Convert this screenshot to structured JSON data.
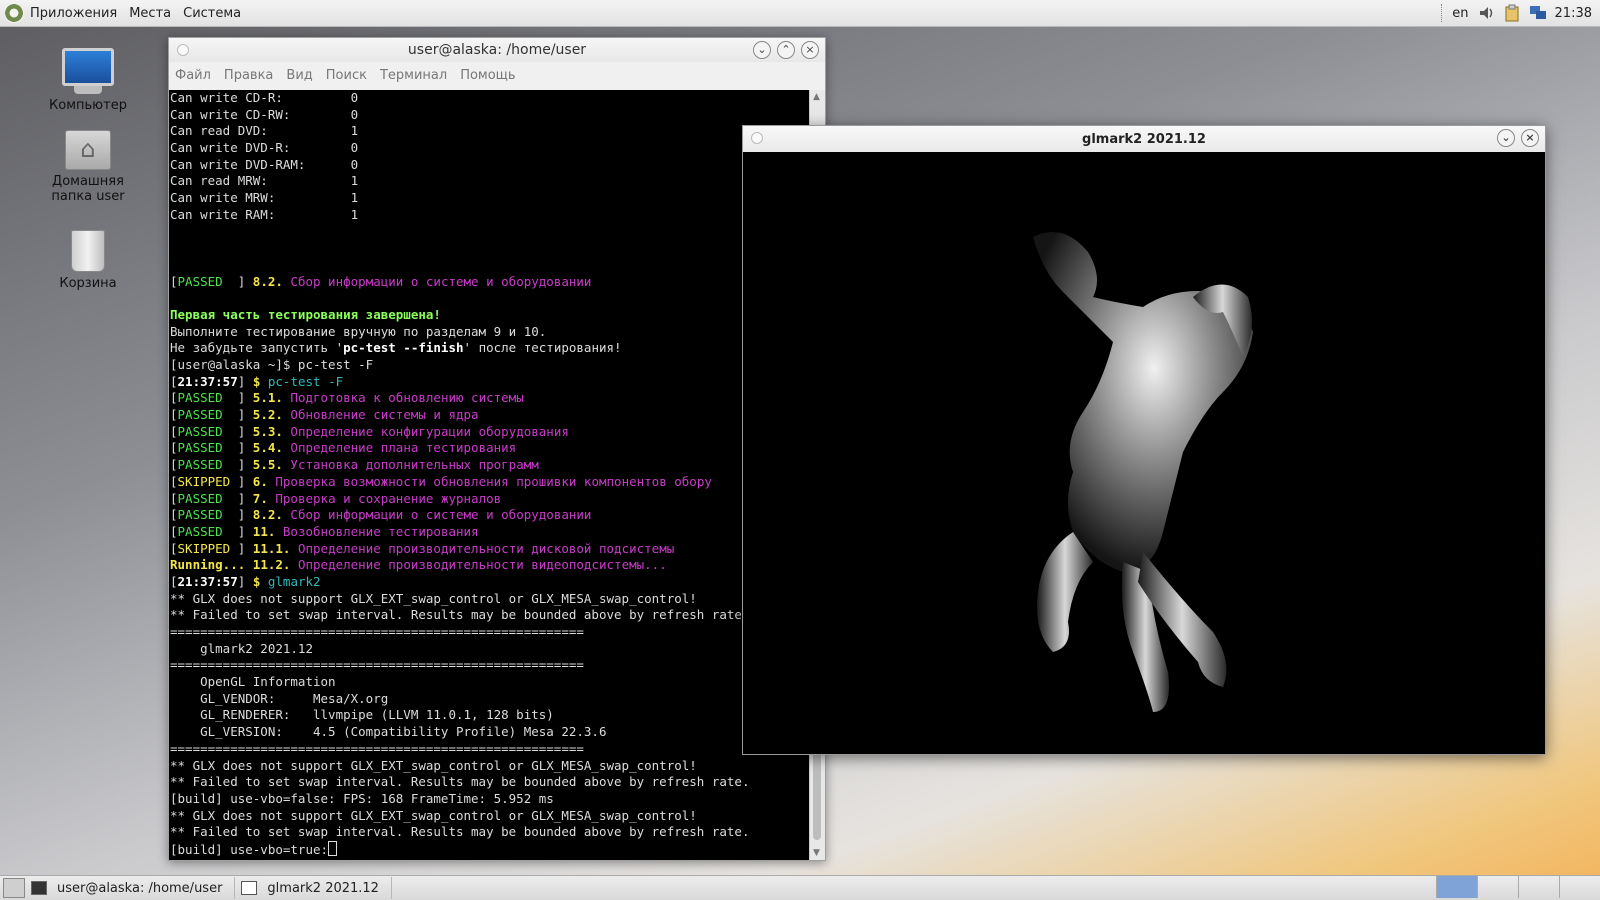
{
  "top_panel": {
    "menu": [
      "Приложения",
      "Места",
      "Система"
    ],
    "lang": "en",
    "time": "21:38"
  },
  "desktop": {
    "icons": [
      {
        "label": "Компьютер"
      },
      {
        "label": "Домашняя папка user"
      },
      {
        "label": "Корзина"
      }
    ]
  },
  "terminal": {
    "title": "user@alaska: /home/user",
    "menu": [
      "Файл",
      "Правка",
      "Вид",
      "Поиск",
      "Терминал",
      "Помощь"
    ],
    "lines": [
      [
        {
          "t": "Can write CD-R:         0"
        }
      ],
      [
        {
          "t": "Can write CD-RW:        0"
        }
      ],
      [
        {
          "t": "Can read DVD:           1"
        }
      ],
      [
        {
          "t": "Can write DVD-R:        0"
        }
      ],
      [
        {
          "t": "Can write DVD-RAM:      0"
        }
      ],
      [
        {
          "t": "Can read MRW:           1"
        }
      ],
      [
        {
          "t": "Can write MRW:          1"
        }
      ],
      [
        {
          "t": "Can write RAM:          1"
        }
      ],
      [
        {
          "t": ""
        }
      ],
      [
        {
          "t": ""
        }
      ],
      [
        {
          "t": ""
        }
      ],
      [
        {
          "t": "["
        },
        {
          "t": "PASSED",
          "c": "g"
        },
        {
          "t": "  ] "
        },
        {
          "t": "8.2.",
          "c": "y b"
        },
        {
          "t": " Сбор информации о системе и оборудовании",
          "c": "m"
        }
      ],
      [
        {
          "t": ""
        }
      ],
      [
        {
          "t": "Первая часть тестирования завершена!",
          "c": "lg"
        }
      ],
      [
        {
          "t": "Выполните тестирование вручную по разделам 9 и 10."
        }
      ],
      [
        {
          "t": "Не забудьте запустить '"
        },
        {
          "t": "pc-test --finish",
          "c": "w b"
        },
        {
          "t": "' после тестирования!"
        }
      ],
      [
        {
          "t": "[user@alaska ~]$ pc-test -F"
        }
      ],
      [
        {
          "t": "["
        },
        {
          "t": "21:37:57",
          "c": "w b"
        },
        {
          "t": "] "
        },
        {
          "t": "$",
          "c": "y b"
        },
        {
          "t": " pc-test -F",
          "c": "c"
        }
      ],
      [
        {
          "t": "["
        },
        {
          "t": "PASSED",
          "c": "g"
        },
        {
          "t": "  ] "
        },
        {
          "t": "5.1.",
          "c": "y b"
        },
        {
          "t": " Подготовка к обновлению системы",
          "c": "m"
        }
      ],
      [
        {
          "t": "["
        },
        {
          "t": "PASSED",
          "c": "g"
        },
        {
          "t": "  ] "
        },
        {
          "t": "5.2.",
          "c": "y b"
        },
        {
          "t": " Обновление системы и ядра",
          "c": "m"
        }
      ],
      [
        {
          "t": "["
        },
        {
          "t": "PASSED",
          "c": "g"
        },
        {
          "t": "  ] "
        },
        {
          "t": "5.3.",
          "c": "y b"
        },
        {
          "t": " Определение конфигурации оборудования",
          "c": "m"
        }
      ],
      [
        {
          "t": "["
        },
        {
          "t": "PASSED",
          "c": "g"
        },
        {
          "t": "  ] "
        },
        {
          "t": "5.4.",
          "c": "y b"
        },
        {
          "t": " Определение плана тестирования",
          "c": "m"
        }
      ],
      [
        {
          "t": "["
        },
        {
          "t": "PASSED",
          "c": "g"
        },
        {
          "t": "  ] "
        },
        {
          "t": "5.5.",
          "c": "y b"
        },
        {
          "t": " Установка дополнительных программ",
          "c": "m"
        }
      ],
      [
        {
          "t": "["
        },
        {
          "t": "SKIPPED",
          "c": "y"
        },
        {
          "t": " ] "
        },
        {
          "t": "6.",
          "c": "y b"
        },
        {
          "t": " Проверка возможности обновления прошивки компонентов обору",
          "c": "m"
        }
      ],
      [
        {
          "t": "["
        },
        {
          "t": "PASSED",
          "c": "g"
        },
        {
          "t": "  ] "
        },
        {
          "t": "7.",
          "c": "y b"
        },
        {
          "t": " Проверка и сохранение журналов",
          "c": "m"
        }
      ],
      [
        {
          "t": "["
        },
        {
          "t": "PASSED",
          "c": "g"
        },
        {
          "t": "  ] "
        },
        {
          "t": "8.2.",
          "c": "y b"
        },
        {
          "t": " Сбор информации о системе и оборудовании",
          "c": "m"
        }
      ],
      [
        {
          "t": "["
        },
        {
          "t": "PASSED",
          "c": "g"
        },
        {
          "t": "  ] "
        },
        {
          "t": "11.",
          "c": "y b"
        },
        {
          "t": " Возобновление тестирования",
          "c": "m"
        }
      ],
      [
        {
          "t": "["
        },
        {
          "t": "SKIPPED",
          "c": "y"
        },
        {
          "t": " ] "
        },
        {
          "t": "11.1.",
          "c": "y b"
        },
        {
          "t": " Определение производительности дисковой подсистемы",
          "c": "m"
        }
      ],
      [
        {
          "t": "Running...",
          "c": "y b"
        },
        {
          "t": " "
        },
        {
          "t": "11.2.",
          "c": "y b"
        },
        {
          "t": " Определение производительности видеоподсистемы...",
          "c": "m"
        }
      ],
      [
        {
          "t": "["
        },
        {
          "t": "21:37:57",
          "c": "w b"
        },
        {
          "t": "] "
        },
        {
          "t": "$",
          "c": "y b"
        },
        {
          "t": " glmark2",
          "c": "c"
        }
      ],
      [
        {
          "t": "** GLX does not support GLX_EXT_swap_control or GLX_MESA_swap_control!"
        }
      ],
      [
        {
          "t": "** Failed to set swap interval. Results may be bounded above by refresh rate."
        }
      ],
      [
        {
          "t": "======================================================="
        }
      ],
      [
        {
          "t": "    glmark2 2021.12"
        }
      ],
      [
        {
          "t": "======================================================="
        }
      ],
      [
        {
          "t": "    OpenGL Information"
        }
      ],
      [
        {
          "t": "    GL_VENDOR:     Mesa/X.org"
        }
      ],
      [
        {
          "t": "    GL_RENDERER:   llvmpipe (LLVM 11.0.1, 128 bits)"
        }
      ],
      [
        {
          "t": "    GL_VERSION:    4.5 (Compatibility Profile) Mesa 22.3.6"
        }
      ],
      [
        {
          "t": "======================================================="
        }
      ],
      [
        {
          "t": "** GLX does not support GLX_EXT_swap_control or GLX_MESA_swap_control!"
        }
      ],
      [
        {
          "t": "** Failed to set swap interval. Results may be bounded above by refresh rate."
        }
      ],
      [
        {
          "t": "[build] use-vbo=false: FPS: 168 FrameTime: 5.952 ms"
        }
      ],
      [
        {
          "t": "** GLX does not support GLX_EXT_swap_control or GLX_MESA_swap_control!"
        }
      ],
      [
        {
          "t": "** Failed to set swap interval. Results may be bounded above by refresh rate."
        }
      ],
      [
        {
          "t": "[build] use-vbo=true:"
        }
      ]
    ]
  },
  "glmark_window": {
    "title": "glmark2 2021.12"
  },
  "taskbar": {
    "tasks": [
      "user@alaska: /home/user",
      "glmark2 2021.12"
    ]
  },
  "colors": {
    "passed": "#4ee24e",
    "skipped": "#f2e64b",
    "section_text": "#c93cc9",
    "command": "#2fb9b9"
  }
}
